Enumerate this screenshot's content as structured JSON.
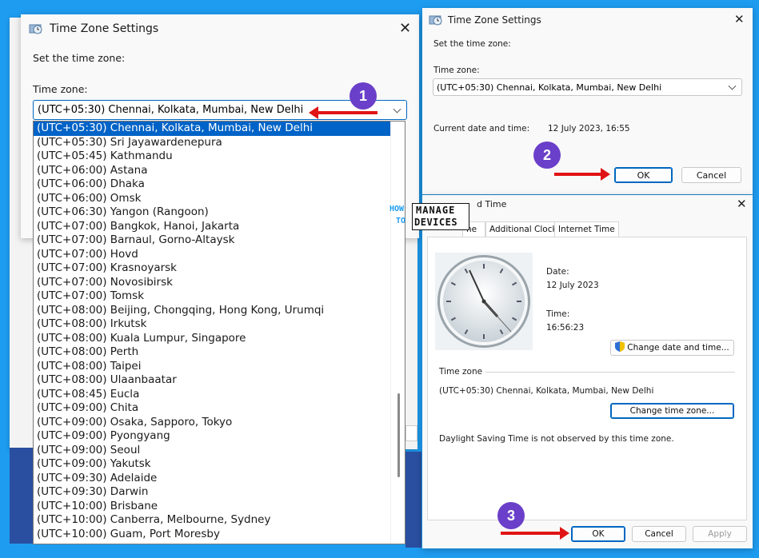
{
  "dialog_left": {
    "title": "Time Zone Settings",
    "set_tz_label": "Set the time zone:",
    "tz_label": "Time zone:",
    "tz_value": "(UTC+05:30) Chennai, Kolkata, Mumbai, New Delhi"
  },
  "dropdown_items": [
    "(UTC+05:30) Chennai, Kolkata, Mumbai, New Delhi",
    "(UTC+05:30) Sri Jayawardenepura",
    "(UTC+05:45) Kathmandu",
    "(UTC+06:00) Astana",
    "(UTC+06:00) Dhaka",
    "(UTC+06:00) Omsk",
    "(UTC+06:30) Yangon (Rangoon)",
    "(UTC+07:00) Bangkok, Hanoi, Jakarta",
    "(UTC+07:00) Barnaul, Gorno-Altaysk",
    "(UTC+07:00) Hovd",
    "(UTC+07:00) Krasnoyarsk",
    "(UTC+07:00) Novosibirsk",
    "(UTC+07:00) Tomsk",
    "(UTC+08:00) Beijing, Chongqing, Hong Kong, Urumqi",
    "(UTC+08:00) Irkutsk",
    "(UTC+08:00) Kuala Lumpur, Singapore",
    "(UTC+08:00) Perth",
    "(UTC+08:00) Taipei",
    "(UTC+08:00) Ulaanbaatar",
    "(UTC+08:45) Eucla",
    "(UTC+09:00) Chita",
    "(UTC+09:00) Osaka, Sapporo, Tokyo",
    "(UTC+09:00) Pyongyang",
    "(UTC+09:00) Seoul",
    "(UTC+09:00) Yakutsk",
    "(UTC+09:30) Adelaide",
    "(UTC+09:30) Darwin",
    "(UTC+10:00) Brisbane",
    "(UTC+10:00) Canberra, Melbourne, Sydney",
    "(UTC+10:00) Guam, Port Moresby"
  ],
  "dialog_right": {
    "title": "Time Zone Settings",
    "set_tz_label": "Set the time zone:",
    "tz_label": "Time zone:",
    "tz_value": "(UTC+05:30) Chennai, Kolkata, Mumbai, New Delhi",
    "current_label": "Current date and time:",
    "current_value": "12 July 2023, 16:55",
    "ok": "OK",
    "cancel": "Cancel"
  },
  "datetime": {
    "title_partial": "d Time",
    "tab_partial": "ne",
    "tab_additional": "Additional Clocks",
    "tab_internet": "Internet Time",
    "date_label": "Date:",
    "date_value": "12 July 2023",
    "time_label": "Time:",
    "time_value": "16:56:23",
    "change_dt": "Change date and time...",
    "tz_section": "Time zone",
    "tz_value": "(UTC+05:30) Chennai, Kolkata, Mumbai, New Delhi",
    "change_tz": "Change time zone...",
    "dst_note": "Daylight Saving Time is not observed by this time zone.",
    "ok": "OK",
    "cancel": "Cancel",
    "apply": "Apply"
  },
  "badges": {
    "one": "1",
    "two": "2",
    "three": "3"
  },
  "watermark": {
    "how": "HOW",
    "to": "TO",
    "manage": "MANAGE",
    "devices": "DEVICES"
  },
  "colors": {
    "background": "#1e9cf0",
    "accent": "#0067c0",
    "badge": "#6a3fc9",
    "arrow": "#e01414"
  }
}
